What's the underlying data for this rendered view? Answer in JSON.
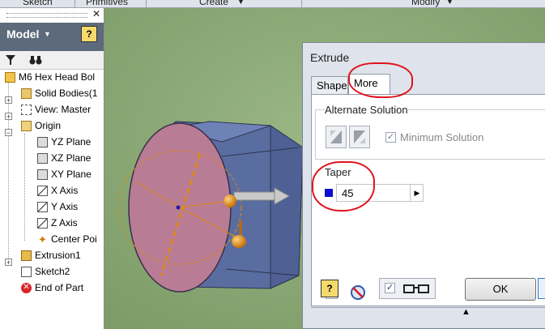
{
  "ribbon": {
    "tabs": [
      "Sketch",
      "Primitives",
      "Create",
      "Modify"
    ]
  },
  "browser": {
    "title": "Model",
    "tree": [
      {
        "label": "M6 Hex Head Bol",
        "icon": "part-icon"
      },
      {
        "label": "Solid Bodies(1",
        "icon": "folder-icon"
      },
      {
        "label": "View: Master",
        "icon": "view-icon"
      },
      {
        "label": "Origin",
        "icon": "open-folder-icon"
      },
      {
        "label": "YZ Plane",
        "icon": "plane-icon"
      },
      {
        "label": "XZ Plane",
        "icon": "plane-icon"
      },
      {
        "label": "XY Plane",
        "icon": "plane-icon"
      },
      {
        "label": "X Axis",
        "icon": "axis-icon"
      },
      {
        "label": "Y Axis",
        "icon": "axis-icon"
      },
      {
        "label": "Z Axis",
        "icon": "axis-icon"
      },
      {
        "label": "Center Poi",
        "icon": "center-point-icon"
      },
      {
        "label": "Extrusion1",
        "icon": "extrusion-icon"
      },
      {
        "label": "Sketch2",
        "icon": "sketch-icon"
      },
      {
        "label": "End of Part",
        "icon": "end-of-part-icon"
      }
    ]
  },
  "dialog": {
    "title": "Extrude",
    "tabs": [
      "Shape",
      "More"
    ],
    "active_tab": "More",
    "alternate_solution": {
      "label": "Alternate Solution",
      "minimum_solution_label": "Minimum Solution",
      "minimum_solution_checked": true
    },
    "taper": {
      "label": "Taper",
      "value": "45"
    },
    "ok_label": "OK"
  },
  "colors": {
    "viewport_bg": "#8aa873",
    "annotation_red": "#e0141e",
    "model_blue": "#5a6da0",
    "highlight_face": "#b87c94",
    "manipulator_orange": "#e08a10"
  }
}
